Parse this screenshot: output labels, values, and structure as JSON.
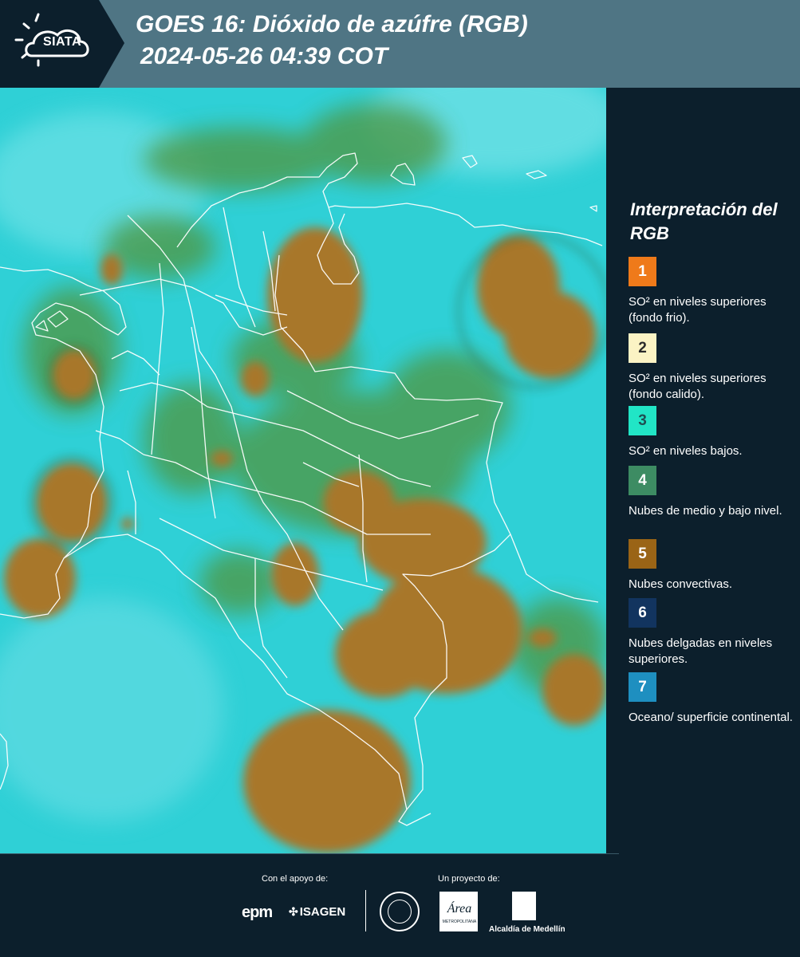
{
  "header": {
    "logo_text": "SIATA",
    "title_line1": "GOES 16: Dióxido de azúfre (RGB)",
    "title_line2": "2024-05-26 04:39 COT"
  },
  "map": {
    "base_color": "#2fd0d6",
    "convective_color": "#a8772a",
    "midlevel_color": "#4e9a4a",
    "border_color": "#ffffff"
  },
  "legend": {
    "title": "Interpretación del RGB",
    "items": [
      {
        "number": "1",
        "color": "#ef7a1a",
        "text_color": "#ffffff",
        "label": "SO² en niveles superiores (fondo frio)."
      },
      {
        "number": "2",
        "color": "#fbf3c4",
        "text_color": "#2a2a2a",
        "label": "SO² en niveles superiores (fondo calido)."
      },
      {
        "number": "3",
        "color": "#21e5c6",
        "text_color": "#1f4f52",
        "label": "SO² en niveles bajos."
      },
      {
        "number": "4",
        "color": "#3d8c63",
        "text_color": "#ffffff",
        "label": "Nubes de medio y bajo nivel."
      },
      {
        "number": "5",
        "color": "#9a6416",
        "text_color": "#ffffff",
        "label": "Nubes convectivas."
      },
      {
        "number": "6",
        "color": "#12345f",
        "text_color": "#ffffff",
        "label": "Nubes delgadas en niveles superiores."
      },
      {
        "number": "7",
        "color": "#1e8fc0",
        "text_color": "#ffffff",
        "label": "Oceano/ superficie continental."
      }
    ]
  },
  "footer": {
    "support_label": "Con el apoyo de:",
    "project_label": "Un proyecto de:",
    "epm_logo": "epm",
    "isagen_logo": "ISAGEN",
    "area_logo": "Área",
    "area_sub": "METROPOLITANA",
    "alcaldia_label": "Alcaldía de Medellín"
  }
}
